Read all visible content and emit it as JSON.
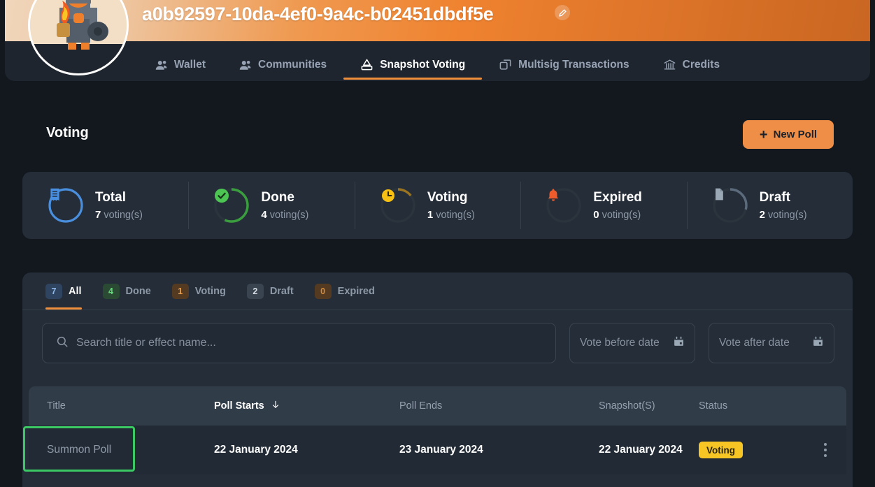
{
  "banner": {
    "title": "a0b92597-10da-4ef0-9a4c-b02451dbdf5e",
    "edit_icon": "pencil-icon",
    "avatar_icon": "pixel-blacksmith-avatar",
    "gradient_from": "#f0d6bb",
    "gradient_to": "#c96621"
  },
  "nav": {
    "items": [
      {
        "label": "Wallet",
        "icon": "people-icon",
        "active": false
      },
      {
        "label": "Communities",
        "icon": "people-icon",
        "active": false
      },
      {
        "label": "Snapshot Voting",
        "icon": "ballot-box-icon",
        "active": true
      },
      {
        "label": "Multisig Transactions",
        "icon": "transactions-icon",
        "active": false
      },
      {
        "label": "Credits",
        "icon": "bank-icon",
        "active": false
      }
    ],
    "active_color": "#ef8f3c"
  },
  "header": {
    "page_title": "Voting",
    "new_poll_label": "New Poll",
    "new_poll_icon": "plus-icon",
    "new_poll_color": "#ef8f47"
  },
  "stats": [
    {
      "label": "Total",
      "count": "7",
      "unit": "voting(s)",
      "icon": "receipt-icon",
      "color": "#4a8fdd",
      "ring_pct": 100
    },
    {
      "label": "Done",
      "count": "4",
      "unit": "voting(s)",
      "icon": "check-circle-icon",
      "color": "#3a9e3f",
      "ring_pct": 57
    },
    {
      "label": "Voting",
      "count": "1",
      "unit": "voting(s)",
      "icon": "clock-icon",
      "color": "#9a7420",
      "ring_pct": 14
    },
    {
      "label": "Expired",
      "count": "0",
      "unit": "voting(s)",
      "icon": "bell-icon",
      "color": "#ef5a2c",
      "ring_pct": 0
    },
    {
      "label": "Draft",
      "count": "2",
      "unit": "voting(s)",
      "icon": "document-icon",
      "color": "#5c6b7c",
      "ring_pct": 29
    }
  ],
  "tabs": [
    {
      "label": "All",
      "count": "7",
      "badge": "blue",
      "active": true
    },
    {
      "label": "Done",
      "count": "4",
      "badge": "green",
      "active": false
    },
    {
      "label": "Voting",
      "count": "1",
      "badge": "amber",
      "active": false
    },
    {
      "label": "Draft",
      "count": "2",
      "badge": "gray",
      "active": false
    },
    {
      "label": "Expired",
      "count": "0",
      "badge": "brown",
      "active": false
    }
  ],
  "filters": {
    "search_placeholder": "Search title or effect name...",
    "search_value": "",
    "search_icon": "search-icon",
    "vote_before_placeholder": "Vote before date",
    "vote_before_value": "",
    "vote_after_placeholder": "Vote after date",
    "vote_after_value": "",
    "calendar_icon": "calendar-icon"
  },
  "table": {
    "columns": [
      "Title",
      "Poll Starts",
      "Poll Ends",
      "Snapshot(S)",
      "Status",
      ""
    ],
    "sorted_column": "Poll Starts",
    "sort_icon": "arrow-down-icon",
    "rows": [
      {
        "title": "Summon Poll",
        "poll_starts": "22 January 2024",
        "poll_ends": "23 January 2024",
        "snapshot": "22 January 2024",
        "status": "Voting",
        "status_color": "#f7c624",
        "menu_icon": "kebab-menu-icon"
      }
    ]
  },
  "selection": {
    "highlight_color": "#3bc963",
    "target": "Summon Poll"
  }
}
